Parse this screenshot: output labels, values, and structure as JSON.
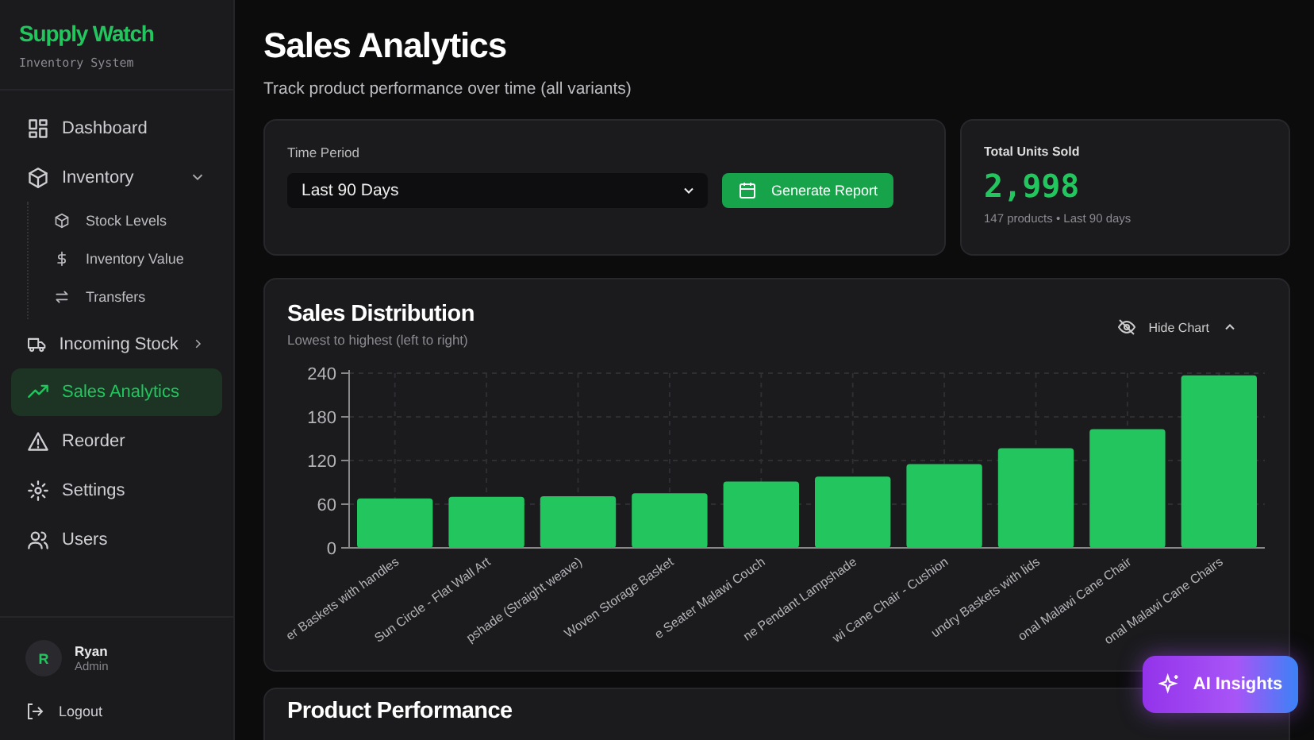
{
  "brand": {
    "name": "Supply Watch",
    "tagline": "Inventory System"
  },
  "sidebar": {
    "items": [
      {
        "label": "Dashboard",
        "selected": false
      },
      {
        "label": "Inventory",
        "selected": false,
        "expanded": true,
        "children": [
          {
            "label": "Stock Levels",
            "selected": false
          },
          {
            "label": "Inventory Value",
            "selected": false
          },
          {
            "label": "Transfers",
            "selected": false
          }
        ]
      },
      {
        "label": "Incoming Stock",
        "selected": false,
        "expanded": false
      },
      {
        "label": "Sales Analytics",
        "selected": true
      },
      {
        "label": "Reorder",
        "selected": false
      },
      {
        "label": "Settings",
        "selected": false
      },
      {
        "label": "Users",
        "selected": false
      }
    ]
  },
  "user": {
    "initial": "R",
    "name": "Ryan",
    "role": "Admin"
  },
  "logout": "Logout",
  "page": {
    "title": "Sales Analytics",
    "subtitle": "Track product performance over time (all variants)"
  },
  "filter": {
    "label": "Time Period",
    "value": "Last 90 Days",
    "button": "Generate Report"
  },
  "summary": {
    "label": "Total Units Sold",
    "value": "2,998",
    "note": "147 products • Last 90 days"
  },
  "distribution": {
    "title": "Sales Distribution",
    "subtitle": "Lowest to highest (left to right)",
    "toggle": "Hide Chart",
    "chart_data": {
      "type": "bar",
      "categories": [
        "er Baskets with handles",
        "Sun Circle - Flat Wall Art",
        "pshade (Straight weave)",
        "Woven Storage Basket",
        "e Seater Malawi Couch",
        "ne Pendant Lampshade",
        "wi Cane Chair - Cushion",
        "undry Baskets with lids",
        "onal Malawi Cane Chair",
        "onal Malawi Cane Chairs"
      ],
      "series": [
        {
          "color": "#22c55e",
          "values": [
            68,
            70,
            71,
            75,
            91,
            98,
            115,
            137,
            163,
            237
          ]
        }
      ],
      "ylim": [
        0,
        240
      ],
      "grid": true,
      "yticks": [
        0,
        60,
        120,
        180,
        240
      ]
    }
  },
  "performance": {
    "title": "Product Performance"
  },
  "insights_button": "AI Insights"
}
